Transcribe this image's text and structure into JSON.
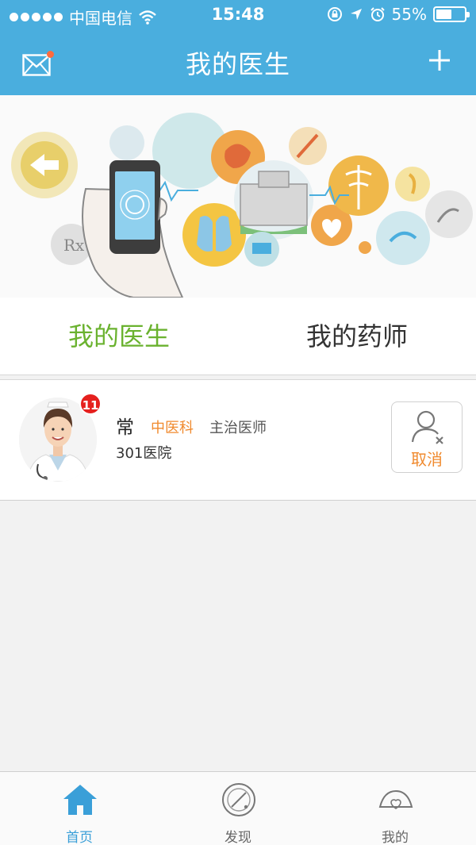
{
  "status_bar": {
    "carrier": "中国电信",
    "time": "15:48",
    "battery_text": "55%",
    "battery_level": 0.55
  },
  "nav": {
    "title": "我的医生",
    "left_icon": "mail-icon",
    "right_icon": "plus-icon"
  },
  "tabs": [
    {
      "label": "我的医生",
      "active": true
    },
    {
      "label": "我的药师",
      "active": false
    }
  ],
  "doctor": {
    "name": "常",
    "department": "中医科",
    "title": "主治医师",
    "hospital": "301医院",
    "unread_count": "11",
    "cancel_label": "取消"
  },
  "tabbar": {
    "items": [
      {
        "label": "首页",
        "icon": "home-icon",
        "active": true
      },
      {
        "label": "发现",
        "icon": "discover-icon",
        "active": false
      },
      {
        "label": "我的",
        "icon": "profile-icon",
        "active": false
      }
    ]
  },
  "colors": {
    "header": "#4aaede",
    "active_tab": "#6ab22f",
    "accent_orange": "#f08a2e",
    "badge": "#e5201e",
    "tabbar_active": "#3a9fd8"
  }
}
